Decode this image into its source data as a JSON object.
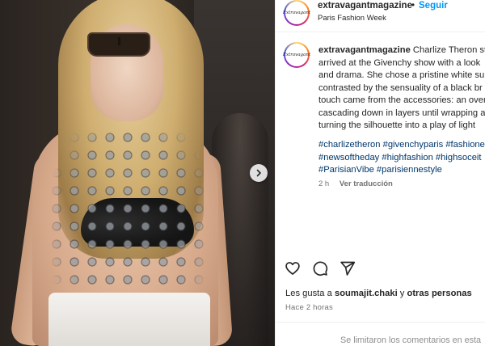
{
  "post": {
    "username": "extravagantmagazine",
    "separator": "•",
    "follow_label": "Seguir",
    "location": "Paris Fashion Week",
    "avatar_text": "Extravagant",
    "caption_lines": [
      "Charlize Theron stu",
      "arrived at the Givenchy show with a look",
      "and drama. She chose a pristine white sui",
      "contrasted by the sensuality of a black br",
      "touch came from the accessories: an over",
      "cascading down in layers until wrapping a",
      "turning the silhouette into a play of light"
    ],
    "hashtag_lines": [
      "#charlizetheron #givenchyparis #fashione",
      "#newsoftheday #highfashion #highsoceit",
      "#ParisianVibe #parisiennestyle"
    ],
    "caption_age": "2 h",
    "translate_label": "Ver traducción",
    "likes_prefix": "Les gusta a",
    "likes_user": "soumajit.chaki",
    "likes_join": "y",
    "likes_others": "otras personas",
    "post_time": "Hace 2 horas",
    "comments_note": "Se limitaron los comentarios en esta"
  },
  "icons": {
    "like": "heart-icon",
    "comment": "speech-bubble-icon",
    "share": "paper-plane-icon",
    "next": "chevron-right-icon"
  },
  "colors": {
    "follow": "#0095f6",
    "hashtag": "#00376b",
    "muted": "#737373"
  }
}
